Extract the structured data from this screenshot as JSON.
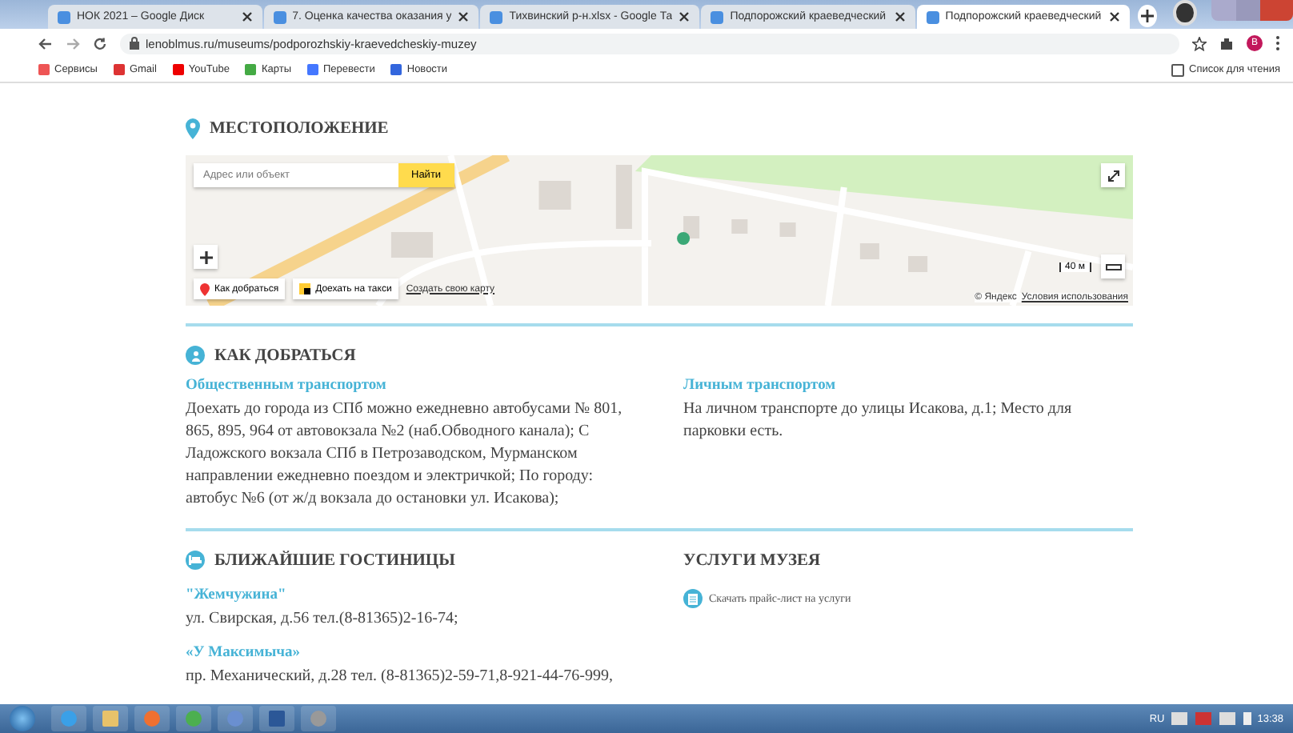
{
  "browser": {
    "tabs": [
      {
        "title": "НОК 2021 – Google Диск",
        "selected": false
      },
      {
        "title": "7. Оценка качества оказания у",
        "selected": false
      },
      {
        "title": "Тихвинский р-н.xlsx - Google Та",
        "selected": false
      },
      {
        "title": "Подпорожский краеведческий",
        "selected": false
      },
      {
        "title": "Подпорожский краеведческий",
        "selected": true
      }
    ],
    "url": "lenoblmus.ru/museums/podporozhskiy-kraevedcheskiy-muzey",
    "profile_initial": "B",
    "bookmarks": [
      {
        "label": "Сервисы"
      },
      {
        "label": "Gmail"
      },
      {
        "label": "YouTube"
      },
      {
        "label": "Карты"
      },
      {
        "label": "Перевести"
      },
      {
        "label": "Новости"
      }
    ],
    "reading_list": "Список для чтения"
  },
  "location": {
    "title": "МЕСТОПОЛОЖЕНИЕ",
    "map": {
      "search_placeholder": "Адрес или объект",
      "search_button": "Найти",
      "route_button": "Как добраться",
      "taxi_button": "Доехать на такси",
      "create_map_link": "Создать свою карту",
      "copyright": "© Яндекс",
      "terms_link": "Условия использования",
      "scale": "40 м"
    }
  },
  "directions": {
    "title": "КАК ДОБРАТЬСЯ",
    "columns": [
      {
        "heading": "Общественным транспортом",
        "text": "Доехать до города из СПб можно ежедневно автобусами № 801, 865, 895, 964 от автовокзала №2 (наб.Обводного канала); С Ладожского вокзала СПб в Петрозаводском, Мурманском направлении ежедневно поездом и электричкой; По городу: автобус №6 (от ж/д вокзала до остановки ул. Исакова);"
      },
      {
        "heading": "Личным транспортом",
        "text": "На личном транспорте до улицы Исакова, д.1; Место для парковки есть."
      }
    ]
  },
  "hotels": {
    "title": "БЛИЖАЙШИЕ ГОСТИНИЦЫ",
    "items": [
      {
        "name": "\"Жемчужина\"",
        "text": "ул. Свирская, д.56 тел.(8-81365)2-16-74;"
      },
      {
        "name": "«У Максимыча»",
        "text": "пр. Механический, д.28 тел. (8-81365)2-59-71,8-921-44-76-999,"
      }
    ]
  },
  "services": {
    "title": "УСЛУГИ МУЗЕЯ",
    "link": "Скачать прайс-лист на услуги"
  },
  "taskbar": {
    "language": "RU",
    "time": "13:38"
  }
}
